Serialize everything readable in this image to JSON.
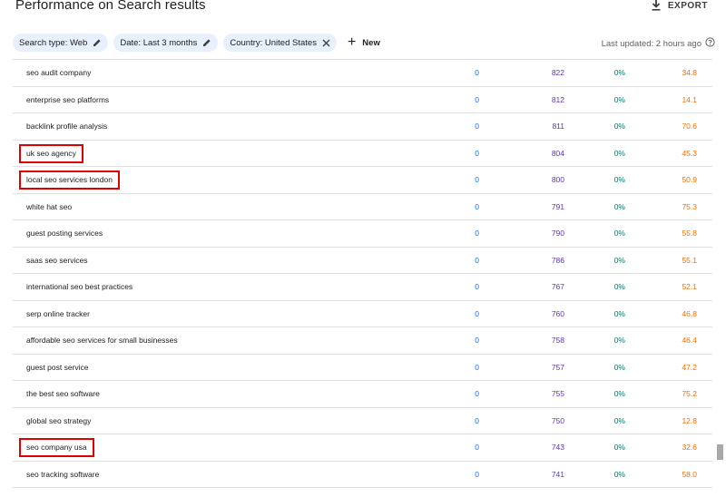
{
  "header": {
    "title": "Performance on Search results",
    "export_label": "EXPORT"
  },
  "filters": {
    "chips": [
      {
        "label": "Search type: Web",
        "icon": "pencil-icon"
      },
      {
        "label": "Date: Last 3 months",
        "icon": "pencil-icon"
      },
      {
        "label": "Country: United States",
        "icon": "close-icon"
      }
    ],
    "new_label": "New",
    "last_updated": "Last updated: 2 hours ago"
  },
  "colors": {
    "clicks": "#1a73e8",
    "impressions": "#5e35b1",
    "ctr": "#00796b",
    "position": "#e8710a",
    "chip_bg": "#e8f0fe",
    "highlight": "#e00000"
  },
  "rows": [
    {
      "query": "seo audit company",
      "clicks": "0",
      "impressions": "822",
      "ctr": "0%",
      "position": "34.8",
      "highlighted": false
    },
    {
      "query": "enterprise seo platforms",
      "clicks": "0",
      "impressions": "812",
      "ctr": "0%",
      "position": "14.1",
      "highlighted": false
    },
    {
      "query": "backlink profile analysis",
      "clicks": "0",
      "impressions": "811",
      "ctr": "0%",
      "position": "70.6",
      "highlighted": false
    },
    {
      "query": "uk seo agency",
      "clicks": "0",
      "impressions": "804",
      "ctr": "0%",
      "position": "45.3",
      "highlighted": true
    },
    {
      "query": "local seo services london",
      "clicks": "0",
      "impressions": "800",
      "ctr": "0%",
      "position": "50.9",
      "highlighted": true
    },
    {
      "query": "white hat seo",
      "clicks": "0",
      "impressions": "791",
      "ctr": "0%",
      "position": "75.3",
      "highlighted": false
    },
    {
      "query": "guest posting services",
      "clicks": "0",
      "impressions": "790",
      "ctr": "0%",
      "position": "55.8",
      "highlighted": false
    },
    {
      "query": "saas seo services",
      "clicks": "0",
      "impressions": "786",
      "ctr": "0%",
      "position": "55.1",
      "highlighted": false
    },
    {
      "query": "international seo best practices",
      "clicks": "0",
      "impressions": "767",
      "ctr": "0%",
      "position": "52.1",
      "highlighted": false
    },
    {
      "query": "serp online tracker",
      "clicks": "0",
      "impressions": "760",
      "ctr": "0%",
      "position": "46.8",
      "highlighted": false
    },
    {
      "query": "affordable seo services for small businesses",
      "clicks": "0",
      "impressions": "758",
      "ctr": "0%",
      "position": "46.4",
      "highlighted": false
    },
    {
      "query": "guest post service",
      "clicks": "0",
      "impressions": "757",
      "ctr": "0%",
      "position": "47.2",
      "highlighted": false
    },
    {
      "query": "the best seo software",
      "clicks": "0",
      "impressions": "755",
      "ctr": "0%",
      "position": "75.2",
      "highlighted": false
    },
    {
      "query": "global seo strategy",
      "clicks": "0",
      "impressions": "750",
      "ctr": "0%",
      "position": "12.8",
      "highlighted": false
    },
    {
      "query": "seo company usa",
      "clicks": "0",
      "impressions": "743",
      "ctr": "0%",
      "position": "32.6",
      "highlighted": true
    },
    {
      "query": "seo tracking software",
      "clicks": "0",
      "impressions": "741",
      "ctr": "0%",
      "position": "58.0",
      "highlighted": false
    }
  ]
}
